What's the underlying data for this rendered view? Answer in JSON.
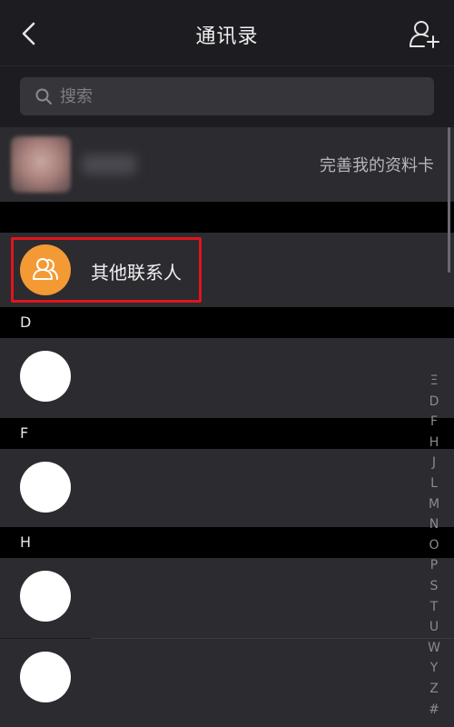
{
  "header": {
    "title": "通讯录",
    "back_icon": "chevron-left-icon",
    "add_icon": "add-contact-icon"
  },
  "search": {
    "placeholder": "搜索",
    "value": ""
  },
  "profile": {
    "link_label": "完善我的资料卡"
  },
  "other_contacts": {
    "label": "其他联系人"
  },
  "sections": [
    {
      "letter": "D"
    },
    {
      "letter": "F"
    },
    {
      "letter": "H"
    }
  ],
  "index_letters": [
    "Ξ",
    "D",
    "F",
    "H",
    "J",
    "L",
    "M",
    "N",
    "O",
    "P",
    "S",
    "T",
    "U",
    "W",
    "Y",
    "Z",
    "#"
  ],
  "colors": {
    "background": "#1d1d21",
    "row": "#2b2b30",
    "section_header": "#000000",
    "accent_orange": "#f39a35",
    "highlight_red": "#e0141d"
  }
}
